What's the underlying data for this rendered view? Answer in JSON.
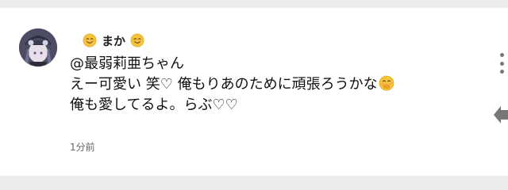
{
  "comment": {
    "author": "まか",
    "author_emoji_left": "smiling-face-icon",
    "author_emoji_right": "smiling-face-icon",
    "reply_to": "@最弱莉亜ちゃん",
    "line2": "えー可愛い 笑♡  俺もりあのために頑張ろうかな",
    "line2_emoji": "hand-over-mouth-face-icon",
    "line3": "俺も愛してるよ。らぶ♡♡",
    "timestamp": "1分前"
  },
  "colors": {
    "background": "#ececec",
    "card": "#ffffff",
    "text": "#111111",
    "muted": "#666666",
    "emoji": "#f6c43c"
  },
  "icons": {
    "more": "vertical-ellipsis-icon",
    "share": "reply-arrow-icon"
  }
}
